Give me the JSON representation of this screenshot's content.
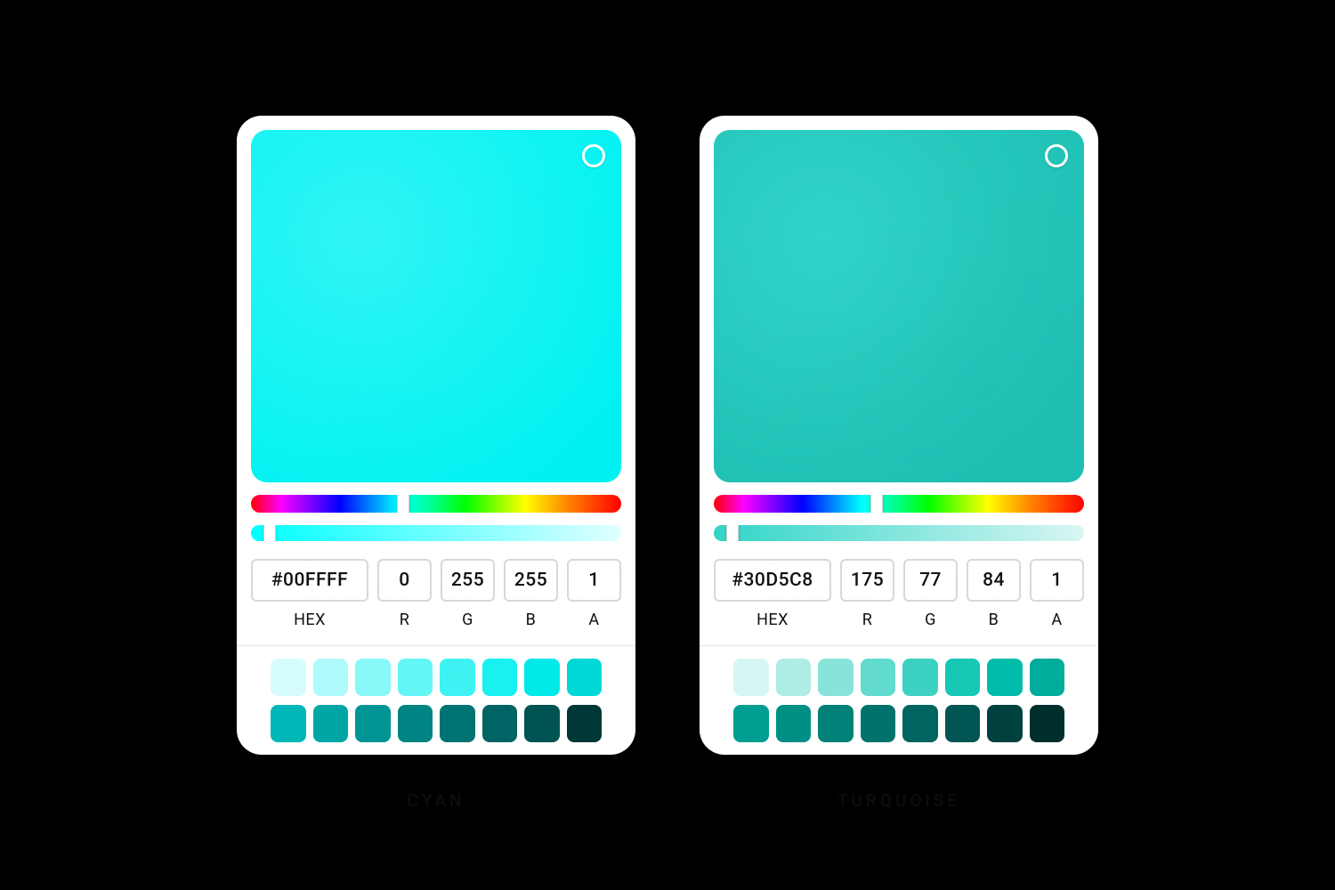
{
  "pickers": [
    {
      "name": "CYAN",
      "main_color": "#00FFFF",
      "swatch_gradient_from": "#2ff5f5",
      "swatch_gradient_to": "#00f2f2",
      "hue_thumb_percent": 41,
      "alpha_thumb_percent": 5,
      "alpha_from": "#00ffff",
      "alpha_to": "#e0ffff",
      "fields": {
        "hex_label": "HEX",
        "hex_value": "#00FFFF",
        "r_label": "R",
        "r_value": "0",
        "g_label": "G",
        "g_value": "255",
        "b_label": "B",
        "b_value": "255",
        "a_label": "A",
        "a_value": "1"
      },
      "palette_light": [
        "#d7fdfd",
        "#b1fbfb",
        "#8bf8f8",
        "#65f6f6",
        "#3ff3f3",
        "#19f1f1",
        "#00eaea",
        "#00d9d9"
      ],
      "palette_dark": [
        "#00b7b7",
        "#00a7a7",
        "#009696",
        "#008686",
        "#007575",
        "#006565",
        "#005454",
        "#003838"
      ]
    },
    {
      "name": "TURQUOISE",
      "main_color": "#30D5C8",
      "swatch_gradient_from": "#2fd1c6",
      "swatch_gradient_to": "#1fbfb4",
      "hue_thumb_percent": 44,
      "alpha_thumb_percent": 5,
      "alpha_from": "#30d5c8",
      "alpha_to": "#d9f6f3",
      "fields": {
        "hex_label": "HEX",
        "hex_value": "#30D5C8",
        "r_label": "R",
        "r_value": "175",
        "g_label": "G",
        "g_value": "77",
        "b_label": "B",
        "b_value": "84",
        "a_label": "A",
        "a_value": "1"
      },
      "palette_light": [
        "#d7f6f3",
        "#b0ede7",
        "#8ae4db",
        "#63dbcf",
        "#3dd2c3",
        "#16c9b7",
        "#00bdab",
        "#00ae9d"
      ],
      "palette_dark": [
        "#00a093",
        "#009187",
        "#00837a",
        "#00746d",
        "#006661",
        "#005754",
        "#004240",
        "#002f2e"
      ]
    }
  ]
}
